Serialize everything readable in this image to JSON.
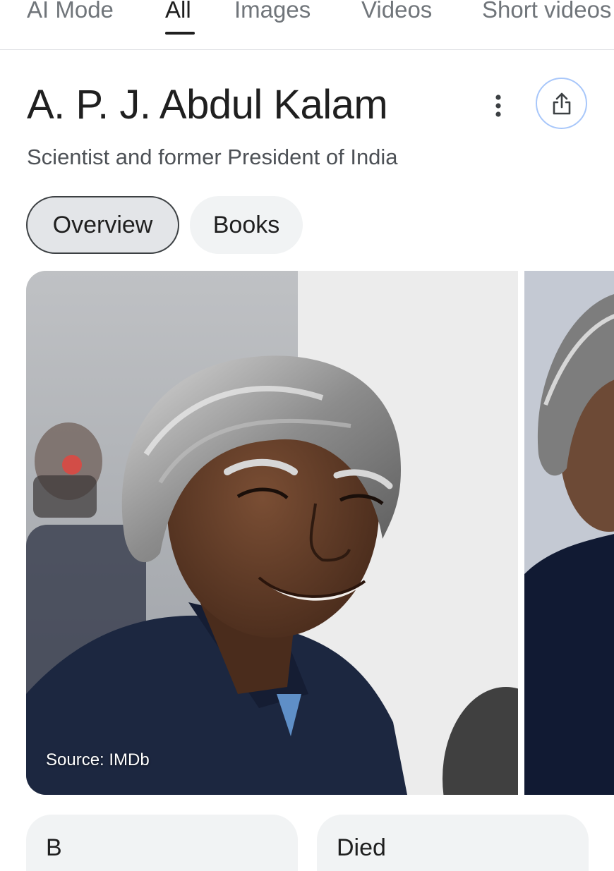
{
  "search_tabs": [
    {
      "label": "AI Mode",
      "active": false
    },
    {
      "label": "All",
      "active": true
    },
    {
      "label": "Images",
      "active": false
    },
    {
      "label": "Videos",
      "active": false
    },
    {
      "label": "Short videos",
      "active": false
    }
  ],
  "entity": {
    "title": "A. P. J. Abdul Kalam",
    "subtitle": "Scientist and former President of India",
    "more_icon": "more-vertical-icon",
    "share_icon": "share-icon"
  },
  "chips": [
    {
      "label": "Overview",
      "selected": true
    },
    {
      "label": "Books",
      "selected": false
    }
  ],
  "images": {
    "main_source": "Source: IMDb"
  },
  "bottom_cards": [
    {
      "label": "B"
    },
    {
      "label": "Died"
    }
  ],
  "colors": {
    "accent_border": "#a8c7fa",
    "selected_chip_bg": "#e3e5e8",
    "chip_bg": "#f1f3f4",
    "muted_text": "#70757a"
  }
}
